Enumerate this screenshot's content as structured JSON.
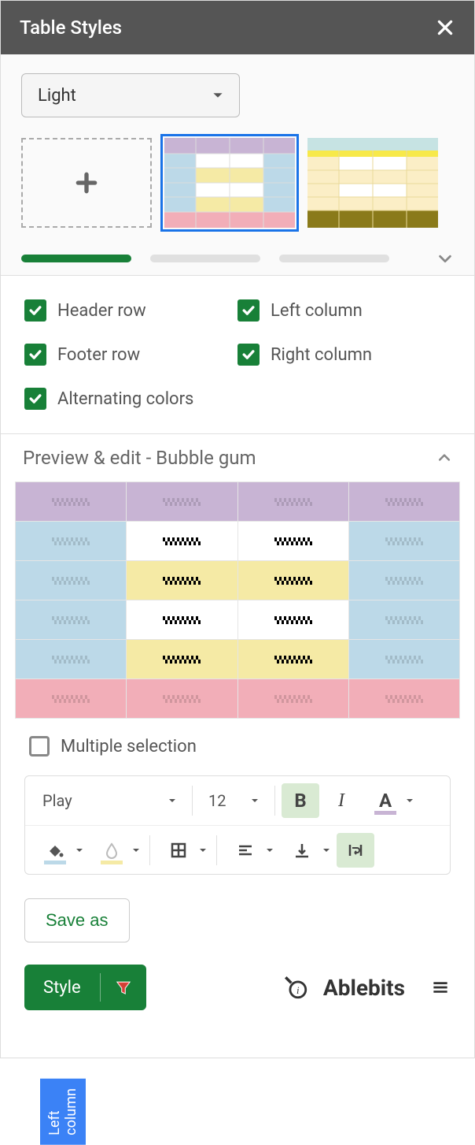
{
  "header": {
    "title": "Table Styles"
  },
  "template_dropdown": {
    "selected": "Light"
  },
  "checkboxes": {
    "header_row": {
      "label": "Header row",
      "checked": true
    },
    "left_column": {
      "label": "Left column",
      "checked": true
    },
    "footer_row": {
      "label": "Footer row",
      "checked": true
    },
    "right_column": {
      "label": "Right column",
      "checked": true
    },
    "alternating_colors": {
      "label": "Alternating colors",
      "checked": true
    }
  },
  "preview": {
    "title": "Preview & edit - Bubble gum",
    "left_column_badge": "Left column"
  },
  "multiple_selection": {
    "label": "Multiple selection",
    "checked": false
  },
  "toolbar": {
    "font_family": "Play",
    "font_size": "12",
    "text_color_underline": "#c8b4d4",
    "fill_color_underline": "#bcd9e8",
    "accent_color_underline": "#f5eaa5"
  },
  "save_as": {
    "label": "Save as"
  },
  "footer": {
    "style_button": "Style",
    "brand": "Ablebits"
  }
}
